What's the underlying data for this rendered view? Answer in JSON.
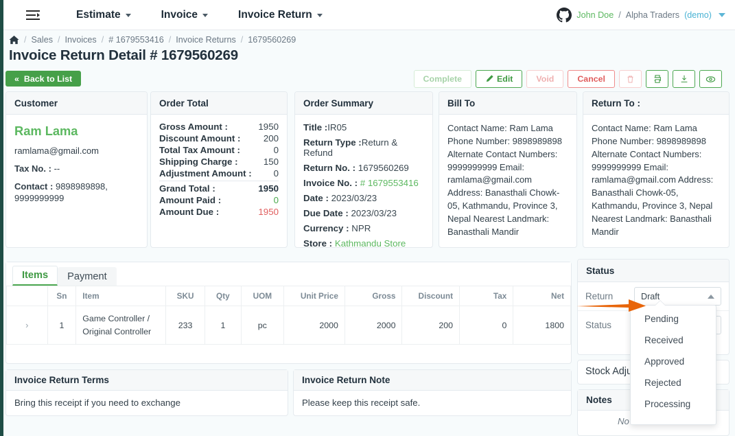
{
  "navbar": {
    "menu_toggle_icon": "hamburger-icon",
    "items": [
      {
        "label": "Estimate"
      },
      {
        "label": "Invoice"
      },
      {
        "label": "Invoice Return"
      }
    ],
    "user": {
      "avatar_icon": "github-avatar-icon",
      "name": "John Doe",
      "separator": "/",
      "company": "Alpha Traders",
      "demo_tag": "(demo)"
    }
  },
  "breadcrumb": {
    "home_icon": "home-icon",
    "items": [
      "Sales",
      "Invoices",
      "# 1679553416",
      "Invoice Returns",
      "1679560269"
    ],
    "separator": "/"
  },
  "page_title": "Invoice Return Detail # 1679560269",
  "toolbar": {
    "back_label": "Back to List",
    "back_icon": "double-chevron-left-icon",
    "actions": [
      {
        "label": "Complete",
        "style": "green-faded",
        "icon": ""
      },
      {
        "label": "Edit",
        "style": "green-outline",
        "icon": "pencil-icon"
      },
      {
        "label": "Void",
        "style": "red-faded",
        "icon": ""
      },
      {
        "label": "Cancel",
        "style": "red-outline",
        "icon": ""
      },
      {
        "label": "",
        "style": "red-faded",
        "icon": "trash-icon"
      },
      {
        "label": "",
        "style": "green-outline",
        "icon": "print-icon"
      },
      {
        "label": "",
        "style": "green-outline",
        "icon": "download-icon"
      },
      {
        "label": "",
        "style": "green-outline",
        "icon": "eye-icon"
      }
    ]
  },
  "customer": {
    "title": "Customer",
    "name": "Ram Lama",
    "email": "ramlama@gmail.com",
    "tax_label": "Tax No. :",
    "tax_value": "--",
    "contact_label": "Contact :",
    "contact_value": "9898989898, 9999999999"
  },
  "order_total": {
    "title": "Order Total",
    "rows": [
      {
        "label": "Gross Amount :",
        "value": "1950",
        "color": ""
      },
      {
        "label": "Discount Amount :",
        "value": "200",
        "color": ""
      },
      {
        "label": "Total Tax Amount :",
        "value": "0",
        "color": ""
      },
      {
        "label": "Shipping Charge :",
        "value": "150",
        "color": ""
      },
      {
        "label": "Adjustment Amount :",
        "value": "0",
        "color": ""
      },
      {
        "label": "Grand Total :",
        "value": "1950",
        "color": "bold"
      },
      {
        "label": "Amount Paid :",
        "value": "0",
        "color": "green"
      },
      {
        "label": "Amount Due :",
        "value": "1950",
        "color": "red"
      }
    ]
  },
  "order_summary": {
    "title": "Order Summary",
    "rows": [
      {
        "label": "Title :",
        "value": "IR05",
        "link": false
      },
      {
        "label": "Return Type :",
        "value": "Return & Refund",
        "link": false
      },
      {
        "label": "Return No. :",
        "value": "1679560269",
        "link": false
      },
      {
        "label": "Invoice No. :",
        "value": "# 1679553416",
        "link": true
      },
      {
        "label": "Date :",
        "value": "2023/03/23",
        "link": false
      },
      {
        "label": "Due Date :",
        "value": "2023/03/23",
        "link": false
      },
      {
        "label": "Currency :",
        "value": "NPR",
        "link": false
      },
      {
        "label": "Store :",
        "value": "Kathmandu Store",
        "link": true
      }
    ]
  },
  "bill_to": {
    "title": "Bill To",
    "body": "Contact Name: Ram Lama Phone Number: 9898989898 Alternate Contact Numbers: 9999999999 Email: ramlama@gmail.com Address: Banasthali Chowk-05, Kathmandu, Province 3, Nepal Nearest Landmark: Banasthali Mandir"
  },
  "return_to": {
    "title": "Return To :",
    "body": "Contact Name: Ram Lama Phone Number: 9898989898 Alternate Contact Numbers: 9999999999 Email: ramlama@gmail.com Address: Banasthali Chowk-05, Kathmandu, Province 3, Nepal Nearest Landmark: Banasthali Mandir"
  },
  "items_panel": {
    "tabs": [
      {
        "label": "Items",
        "active": true
      },
      {
        "label": "Payment",
        "active": false
      }
    ],
    "columns": [
      "",
      "Sn",
      "Item",
      "SKU",
      "Qty",
      "UOM",
      "Unit Price",
      "Gross",
      "Discount",
      "Tax",
      "Net"
    ],
    "rows": [
      {
        "expand_icon": "chevron-right-icon",
        "sn": "1",
        "item": "Game Controller / Original Controller",
        "sku": "233",
        "qty": "1",
        "uom": "pc",
        "unit_price": "2000",
        "gross": "2000",
        "discount": "200",
        "tax": "0",
        "net": "1800"
      }
    ]
  },
  "terms": {
    "title": "Invoice Return Terms",
    "body": "Bring this receipt if you need to exchange"
  },
  "note": {
    "title": "Invoice Return Note",
    "body": "Please keep this receipt safe."
  },
  "status_panel": {
    "title": "Status",
    "return_label": "Return",
    "return_value": "Draft",
    "status_label": "Status",
    "status_value": ""
  },
  "stock_adjustment": {
    "label": "Stock Adjustment"
  },
  "notes_panel": {
    "title": "Notes",
    "empty_text": "No notes created."
  },
  "dropdown": {
    "options": [
      "Pending",
      "Received",
      "Approved",
      "Rejected",
      "Processing"
    ]
  },
  "colors": {
    "accent_green": "#46a049",
    "link_green": "#5cb860",
    "danger_red": "#e05d5d",
    "rail_dark": "#1f4d45",
    "annotation_orange": "#e8650a",
    "page_bg": "#f7fbfc"
  }
}
